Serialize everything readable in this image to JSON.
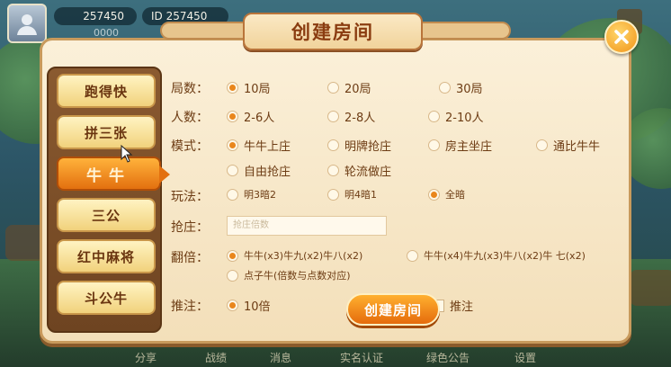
{
  "header": {
    "coins": "257450",
    "player_id": "ID 257450",
    "sub_text": "0000"
  },
  "dialog": {
    "title": "创建房间"
  },
  "sidebar": {
    "items": [
      {
        "label": "跑得快",
        "active": false
      },
      {
        "label": "拼三张",
        "active": false
      },
      {
        "label": "牛牛",
        "active": true
      },
      {
        "label": "三公",
        "active": false
      },
      {
        "label": "红中麻将",
        "active": false
      },
      {
        "label": "斗公牛",
        "active": false
      }
    ]
  },
  "form": {
    "rounds": {
      "label": "局数：",
      "options": [
        "10局",
        "20局",
        "30局"
      ],
      "selected": 0
    },
    "players": {
      "label": "人数：",
      "options": [
        "2-6人",
        "2-8人",
        "2-10人"
      ],
      "selected": 0
    },
    "mode": {
      "label": "模式：",
      "options": [
        "牛牛上庄",
        "明牌抢庄",
        "房主坐庄",
        "通比牛牛",
        "自由抢庄",
        "轮流做庄"
      ],
      "selected": 0
    },
    "play": {
      "label": "玩法：",
      "options": [
        "明3暗2",
        "明4暗1",
        "全暗"
      ],
      "selected": 2
    },
    "grab": {
      "label": "抢庄：",
      "placeholder": "抢庄倍数"
    },
    "multiplier": {
      "label": "翻倍：",
      "options": [
        "牛牛(x3)牛九(x2)牛八(x2)",
        "牛牛(x4)牛九(x3)牛八(x2)牛 七(x2)",
        "点子牛(倍数与点数对应)"
      ],
      "selected": 0
    },
    "bet": {
      "label": "推注：",
      "options": [
        "10倍"
      ],
      "selected": 0,
      "checkbox_label": "推注"
    },
    "create_label": "创建房间"
  },
  "bottom_nav": [
    "分享",
    "战绩",
    "消息",
    "实名认证",
    "绿色公告",
    "设置"
  ],
  "colors": {
    "accent": "#e9861c",
    "panel": "#fbf0d9",
    "text": "#6d3c14",
    "active_tab": "#e3700f"
  }
}
